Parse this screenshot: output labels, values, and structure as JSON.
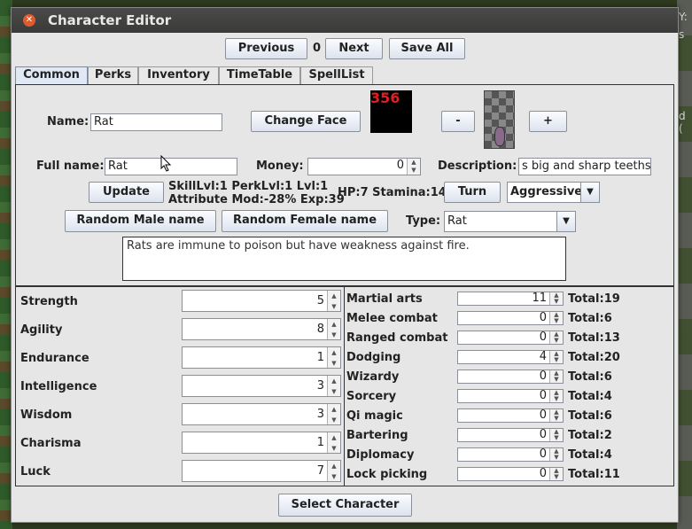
{
  "window": {
    "title": "Character Editor"
  },
  "nav": {
    "previous": "Previous",
    "index": "0",
    "next": "Next",
    "save_all": "Save All"
  },
  "tabs": [
    "Common",
    "Perks",
    "Inventory",
    "TimeTable",
    "SpellList"
  ],
  "character": {
    "name_label": "Name:",
    "name_value": "Rat",
    "change_face": "Change Face",
    "face_number": "356",
    "minus": "-",
    "plus": "+",
    "fullname_label": "Full name:",
    "fullname_value": "Rat",
    "money_label": "Money:",
    "money_value": "0",
    "description_label": "Description:",
    "description_value": "s big and sharp teeths.",
    "update": "Update",
    "levels_line1": "SkillLvl:1 PerkLvl:1 Lvl:1",
    "levels_line2": "Attribute Mod:-28% Exp:39",
    "hp_stamina": "HP:7 Stamina:14",
    "turn": "Turn",
    "attitude": "Aggressive",
    "random_male": "Random Male name",
    "random_female": "Random Female name",
    "type_label": "Type:",
    "type_value": "Rat",
    "notes": "Rats are immune to poison but have weakness against fire."
  },
  "attributes": [
    {
      "label": "Strength",
      "value": "5"
    },
    {
      "label": "Agility",
      "value": "8"
    },
    {
      "label": "Endurance",
      "value": "1"
    },
    {
      "label": "Intelligence",
      "value": "3"
    },
    {
      "label": "Wisdom",
      "value": "3"
    },
    {
      "label": "Charisma",
      "value": "1"
    },
    {
      "label": "Luck",
      "value": "7"
    }
  ],
  "skills": [
    {
      "label": "Martial arts",
      "value": "11",
      "total": "Total:19"
    },
    {
      "label": "Melee combat",
      "value": "0",
      "total": "Total:6"
    },
    {
      "label": "Ranged combat",
      "value": "0",
      "total": "Total:13"
    },
    {
      "label": "Dodging",
      "value": "4",
      "total": "Total:20"
    },
    {
      "label": "Wizardy",
      "value": "0",
      "total": "Total:6"
    },
    {
      "label": "Sorcery",
      "value": "0",
      "total": "Total:4"
    },
    {
      "label": "Qi magic",
      "value": "0",
      "total": "Total:6"
    },
    {
      "label": "Bartering",
      "value": "0",
      "total": "Total:2"
    },
    {
      "label": "Diplomacy",
      "value": "0",
      "total": "Total:4"
    },
    {
      "label": "Lock picking",
      "value": "0",
      "total": "Total:11"
    }
  ],
  "footer": {
    "select_character": "Select Character"
  },
  "background": {
    "right_text_1": "Y:",
    "right_text_2": "s",
    "right_text_3": "d ("
  }
}
